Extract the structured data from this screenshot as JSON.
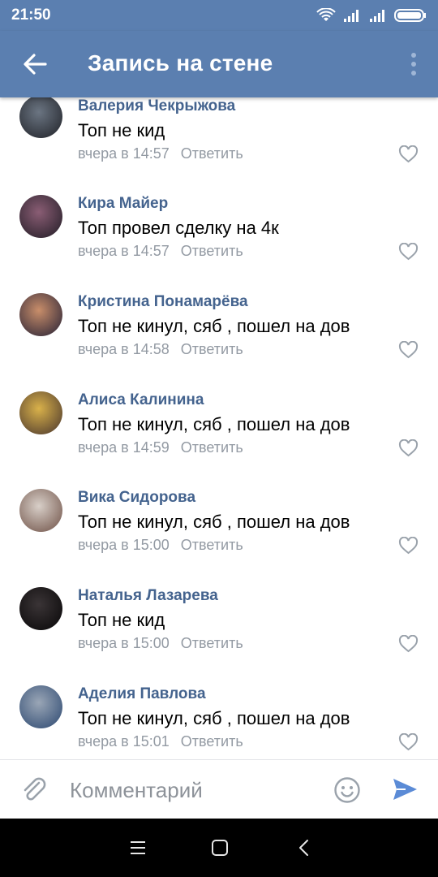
{
  "status_bar": {
    "time": "21:50",
    "icons": [
      "wifi-icon",
      "signal-icon",
      "signal-icon",
      "battery-icon"
    ]
  },
  "header": {
    "title": "Запись на стене",
    "back_icon": "back-arrow-icon",
    "menu_icon": "more-vertical-icon"
  },
  "comments": [
    {
      "author": "Валерия Чекрыжова",
      "text": "Топ не кид",
      "time": "вчера в 14:57",
      "reply_label": "Ответить",
      "avatar_colors": [
        "#6b7582",
        "#2a2d34"
      ]
    },
    {
      "author": "Кира Майер",
      "text": "Топ провел сделку на 4к",
      "time": "вчера в 14:57",
      "reply_label": "Ответить",
      "avatar_colors": [
        "#8a5d74",
        "#2f2530"
      ]
    },
    {
      "author": "Кристина Понамарёва",
      "text": "Топ не кинул, сяб , пошел на дов",
      "time": "вчера в 14:58",
      "reply_label": "Ответить",
      "avatar_colors": [
        "#c98e6a",
        "#3b2f3c"
      ]
    },
    {
      "author": "Алиса Калинина",
      "text": "Топ не кинул, сяб , пошел на дов",
      "time": "вчера в 14:59",
      "reply_label": "Ответить",
      "avatar_colors": [
        "#d9b14a",
        "#5c4631"
      ]
    },
    {
      "author": "Вика Сидорова",
      "text": "Топ не кинул, сяб , пошел на дов",
      "time": "вчера в 15:00",
      "reply_label": "Ответить",
      "avatar_colors": [
        "#d8cfc8",
        "#7d6258"
      ]
    },
    {
      "author": "Наталья Лазарева",
      "text": "Топ не кид",
      "time": "вчера в 15:00",
      "reply_label": "Ответить",
      "avatar_colors": [
        "#3a3436",
        "#0f0d0e"
      ]
    },
    {
      "author": "Аделия Павлова",
      "text": "Топ не кинул, сяб , пошел на дов",
      "time": "вчера в 15:01",
      "reply_label": "Ответить",
      "avatar_colors": [
        "#9aa6b6",
        "#3b557a"
      ]
    }
  ],
  "composer": {
    "placeholder": "Комментарий",
    "attach_icon": "paperclip-icon",
    "emoji_icon": "smiley-icon",
    "send_icon": "send-icon"
  },
  "navigation": {
    "icons": [
      "menu-icon",
      "home-square-icon",
      "back-chevron-icon"
    ]
  },
  "colors": {
    "accent": "#5b7fb0",
    "author": "#44638e",
    "meta": "#939aa3",
    "send": "#5b8bd6"
  }
}
